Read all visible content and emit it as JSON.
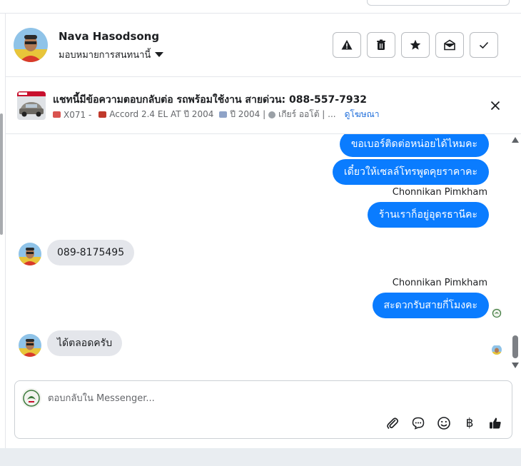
{
  "contact": {
    "name": "Nava Hasodsong",
    "assign_label": "มอบหมายการสนทนานี้"
  },
  "header_actions": [
    {
      "icon": "warning-icon",
      "label": "spam"
    },
    {
      "icon": "trash-icon",
      "label": "delete"
    },
    {
      "icon": "star-icon",
      "label": "follow up"
    },
    {
      "icon": "envelope-open-icon",
      "label": "mark unread"
    },
    {
      "icon": "check-icon",
      "label": "done"
    }
  ],
  "ad": {
    "title": "แชทนี้มีข้อความตอบกลับต่อ รถพร้อมใช้งาน สายด่วน: 088-557-7932",
    "code": "X071 -",
    "model": "Accord 2.4 EL AT ปี 2004",
    "year": "ปี 2004 |",
    "gear": "เกียร์ ออโต้ | ...",
    "link": "ดูโฆษณา"
  },
  "messages": {
    "m1": "ขอเบอร์ติดต่อหน่อยได้ไหมคะ",
    "m2": "เดี๋ยวให้เซลล์โทรพูดคุยราคาคะ",
    "sender1": "Chonnikan Pimkham",
    "m3": "ร้านเราก็อยู่อุดรธานีคะ",
    "m4": "089-8175495",
    "sender2": "Chonnikan Pimkham",
    "m5": "สะดวกรับสายกี่โมงคะ",
    "m6": "ได้ตลอดครับ"
  },
  "composer": {
    "placeholder": "ตอบกลับใน Messenger...",
    "tools": [
      "paperclip-icon",
      "chat-bubble-icon",
      "emoji-icon",
      "baht-icon",
      "thumbs-up-icon"
    ],
    "baht_symbol": "฿"
  },
  "colors": {
    "outgoing_bubble": "#0a7cff",
    "incoming_bubble": "#e4e6eb",
    "link": "#216fdb"
  }
}
